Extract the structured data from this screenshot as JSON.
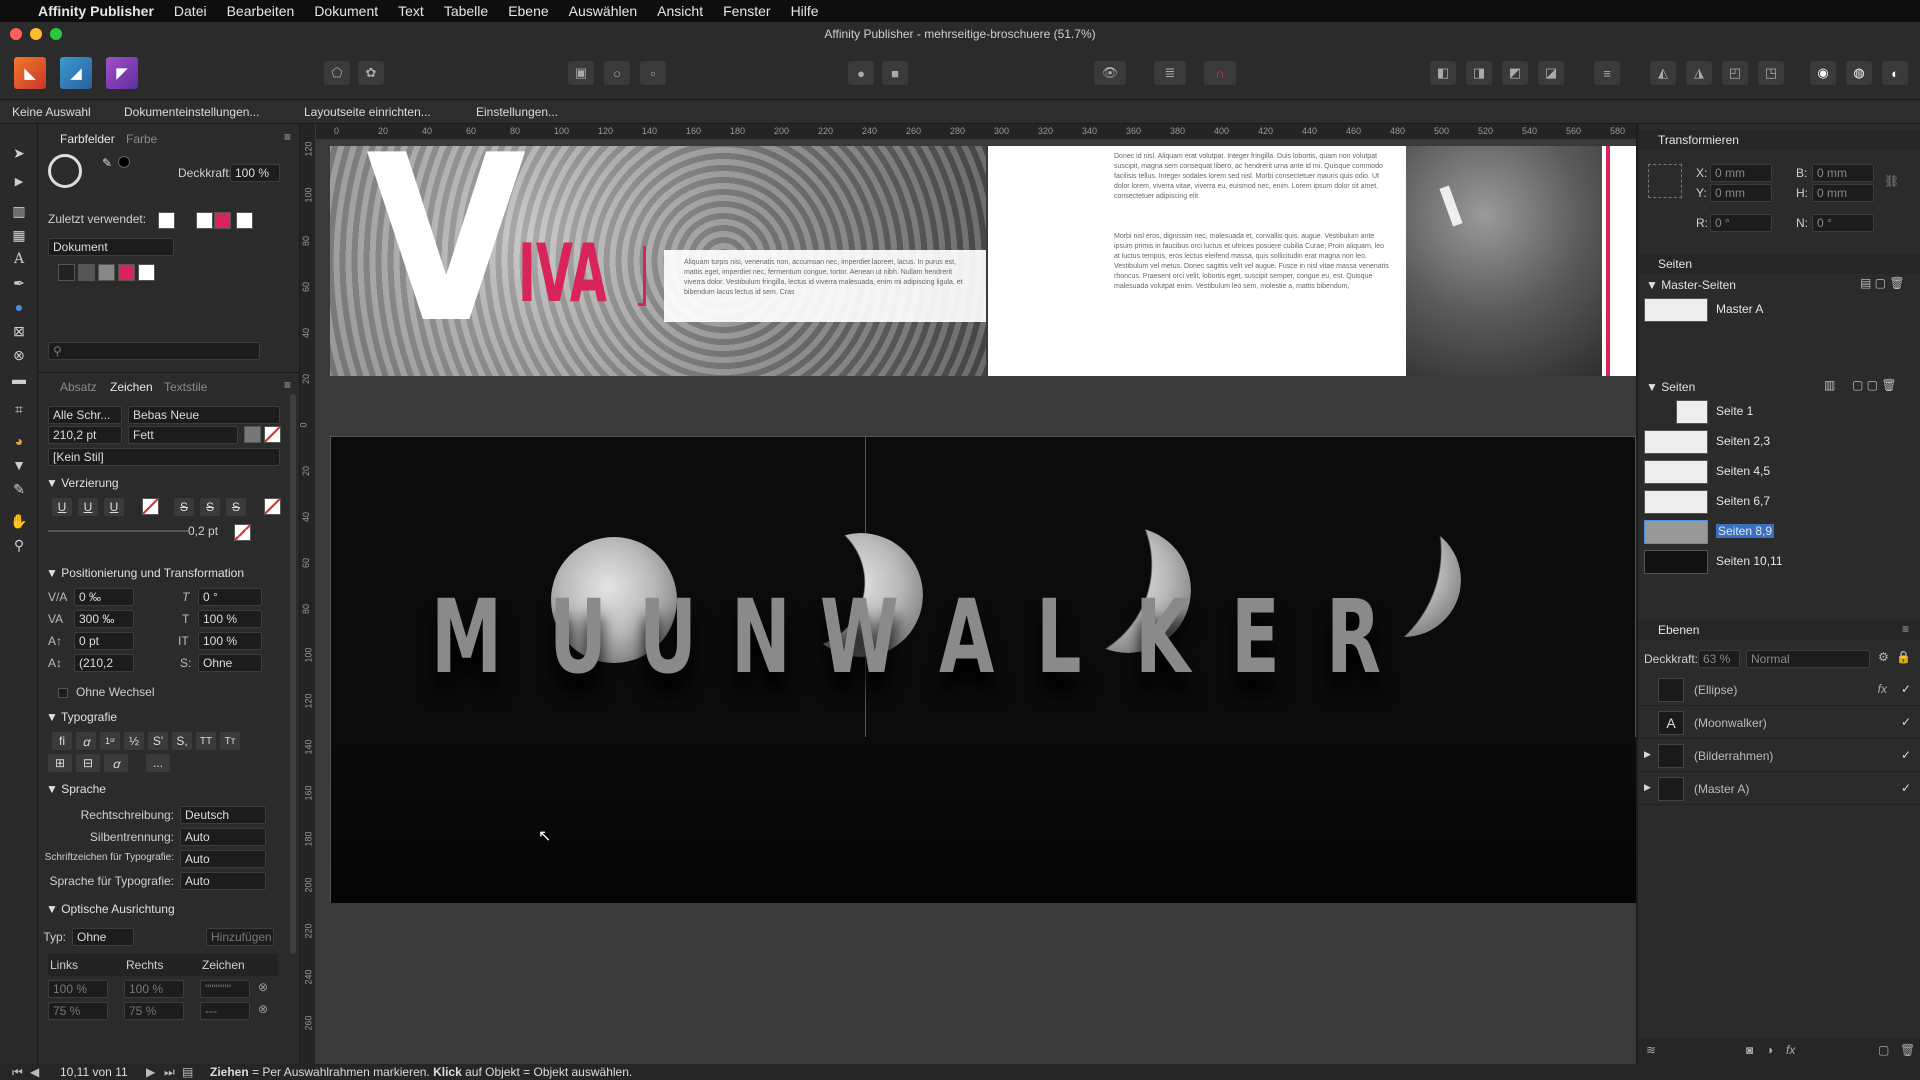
{
  "menubar": {
    "app": "Affinity Publisher",
    "items": [
      "Datei",
      "Bearbeiten",
      "Dokument",
      "Text",
      "Tabelle",
      "Ebene",
      "Auswählen",
      "Ansicht",
      "Fenster",
      "Hilfe"
    ]
  },
  "window": {
    "title": "Affinity Publisher - mehrseitige-broschuere (51.7%)"
  },
  "context": {
    "selection": "Keine Auswahl",
    "doc_settings": "Dokumenteinstellungen...",
    "layout": "Layoutseite einrichten...",
    "settings": "Einstellungen..."
  },
  "colors_panel": {
    "tab_active": "Farbfelder",
    "tab_other": "Farbe",
    "opacity_label": "Deckkraft:",
    "opacity_value": "100 %",
    "recent_label": "Zuletzt verwendet:",
    "palette": "Dokument",
    "accent": "#d9245a"
  },
  "char_panel": {
    "tabs": [
      "Absatz",
      "Zeichen",
      "Textstile"
    ],
    "font_collection": "Alle Schr...",
    "font_family": "Bebas Neue",
    "font_size": "210,2 pt",
    "font_weight": "Fett",
    "style": "[Kein Stil]",
    "deco_header": "Verzierung",
    "deco_weight": "0,2 pt",
    "pos_header": "Positionierung und Transformation",
    "kerning": "0 ‰",
    "tracking": "300 ‰",
    "baseline": "0 pt",
    "leading": "(210,2",
    "skew": "0 °",
    "hscale": "100 %",
    "vscale": "100 %",
    "case_value": "Ohne",
    "no_break": "Ohne Wechsel",
    "typo_header": "Typografie",
    "typo_more": "...",
    "lang_header": "Sprache",
    "spell_label": "Rechtschreibung:",
    "spell_value": "Deutsch",
    "hyph_label": "Silbentrennung:",
    "hyph_value": "Auto",
    "typoscript_label": "Schriftzeichen für Typografie:",
    "typoscript_value": "Auto",
    "typolang_label": "Sprache für Typografie:",
    "typolang_value": "Auto",
    "optical_header": "Optische Ausrichtung",
    "type_label": "Typ:",
    "type_value": "Ohne",
    "add_button": "Hinzufügen",
    "col_left": "Links",
    "col_right": "Rechts",
    "col_char": "Zeichen",
    "row1_left": "100 %",
    "row1_right": "100 %",
    "row1_char": "\"\"'\"\"'\"",
    "row2_left": "75 %",
    "row2_right": "75 %",
    "row2_char": "---"
  },
  "ruler_ticks": [
    "0",
    "20",
    "40",
    "60",
    "80",
    "100",
    "120",
    "140",
    "160",
    "180",
    "200",
    "220",
    "240",
    "260",
    "280",
    "300",
    "320",
    "340",
    "360",
    "380",
    "400",
    "420",
    "440",
    "460",
    "480",
    "500",
    "520",
    "540",
    "560",
    "580"
  ],
  "ruler_left_ticks": [
    "120",
    "100",
    "80",
    "60",
    "40",
    "20",
    "0",
    "20",
    "40",
    "60",
    "80",
    "100",
    "120",
    "140",
    "160",
    "180",
    "200",
    "220",
    "240",
    "260"
  ],
  "spread_top": {
    "headline_v": "V",
    "headline_iva": "IVA",
    "text_block1": "Aliquam turpis nisi, venenatis non, accumsan nec, imperdiet laoreet, lacus. In purus est, mattis eget, imperdiet nec, fermentum congue, tortor. Aenean ut nibh. Nullam hendrerit viverra dolor. Vestibulum fringilla, lectus id viverra malesuada, enim mi adipiscing ligula, et bibendum lacus lectus id sem. Cras",
    "text_col1": "Donec id nisl. Aliquam erat volutpat. Integer fringilla. Duis lobortis, quam non volutpat suscipit, magna sem consequat libero, ac hendrerit urna ante id mi. Quisque commodo facilisis tellus. Integer sodales lorem sed nisl. Morbi consectetuer mauris quis odio. Ut dolor lorem, viverra vitae, viverra eu, euismod nec, enim. Lorem ipsum dolor sit amet, consectetuer adipiscing elit.",
    "text_col2": "Morbi nisl eros, dignissim nec, malesuada et, convallis quis, augue. Vestibulum ante ipsum primis in faucibus orci luctus et ultrices posuere cubilia Curae; Proin aliquam, leo at luctus tempus, eros lectus eleifend massa, quis sollicitudin erat magna non leo. Vestibulum vel metus. Donec sagittis velit vel augue. Fusce in nisl vitae massa venenatis rhoncus. Praesent orci velit, lobortis eget, suscipit semper, congue eu, est. Quisque malesuada volutpat enim. Vestibulum leo sem, molestie a, mattis bibendum,"
  },
  "spread_main": {
    "letters": [
      "M",
      "U",
      "U",
      "N",
      "W",
      "A",
      "L",
      "K",
      "E",
      "R"
    ]
  },
  "transform_panel": {
    "title": "Transformieren",
    "x_label": "X:",
    "x_value": "0 mm",
    "y_label": "Y:",
    "y_value": "0 mm",
    "w_label": "B:",
    "w_value": "0 mm",
    "h_label": "H:",
    "h_value": "0 mm",
    "r_label": "R:",
    "r_value": "0 °",
    "s_label": "N:",
    "s_value": "0 °"
  },
  "pages_panel": {
    "title": "Seiten",
    "master_header": "Master-Seiten",
    "master_a": "Master A",
    "pages_header": "Seiten",
    "pages": [
      "Seite 1",
      "Seiten 2,3",
      "Seiten 4,5",
      "Seiten 6,7",
      "Seiten 8,9",
      "Seiten 10,11"
    ],
    "selected_index": 4
  },
  "layers_panel": {
    "title": "Ebenen",
    "opacity_label": "Deckkraft:",
    "opacity_value": "63 %",
    "blend": "Normal",
    "layers": [
      {
        "name": "(Ellipse)",
        "icon": "",
        "fx": "fx",
        "check": "✓"
      },
      {
        "name": "(Moonwalker)",
        "icon": "A",
        "fx": "",
        "check": "✓"
      },
      {
        "name": "(Bilderrahmen)",
        "icon": "",
        "fx": "",
        "check": "✓"
      },
      {
        "name": "(Master A)",
        "icon": "",
        "fx": "",
        "check": "✓"
      }
    ]
  },
  "status": {
    "page_indicator": "10,11 von 11",
    "hint_drag": "Ziehen",
    "hint_drag_text": " = Per Auswahlrahmen markieren. ",
    "hint_click": "Klick",
    "hint_click_text": " auf Objekt = Objekt auswählen."
  }
}
